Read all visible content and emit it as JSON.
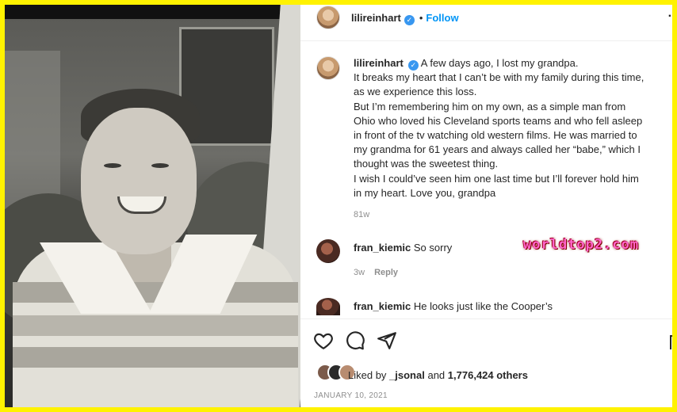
{
  "post": {
    "username": "lilireinhart",
    "follow_label": "Follow",
    "separator": "•",
    "more_label": "·",
    "caption_lines": [
      "A few days ago, I lost my grandpa.",
      "It breaks my heart that I can’t be with my family during this time,",
      "as we experience this loss.",
      "But I’m remembering him on my own, as a simple man from",
      "Ohio who loved his Cleveland sports teams and who fell asleep",
      "in front of the tv watching old western films. He was married to",
      "my grandma for 61 years and always called her “babe,” which I",
      "thought was the sweetest thing.",
      "I wish I could’ve seen him one last time but I’ll forever hold him",
      "in my heart. Love you, grandpa"
    ],
    "caption_age": "81w",
    "date": "JANUARY 10, 2021"
  },
  "comments": [
    {
      "username": "fran_kiemic",
      "text": "So sorry",
      "age": "3w",
      "reply_label": "Reply"
    },
    {
      "username": "fran_kiemic",
      "text": "He looks just like the Cooper’s"
    }
  ],
  "likes": {
    "prefix": "Liked by",
    "liker": "_jsonal",
    "connector": "and",
    "count": "1,776,424 others"
  },
  "watermark": "worldtop2.com",
  "colors": {
    "border": "#fff200",
    "accent": "#0095f6",
    "verified": "#3897f0",
    "muted": "#8e8e8e"
  },
  "icons": [
    "heart-icon",
    "comment-icon",
    "share-icon",
    "bookmark-icon",
    "verified-icon",
    "more-icon"
  ]
}
